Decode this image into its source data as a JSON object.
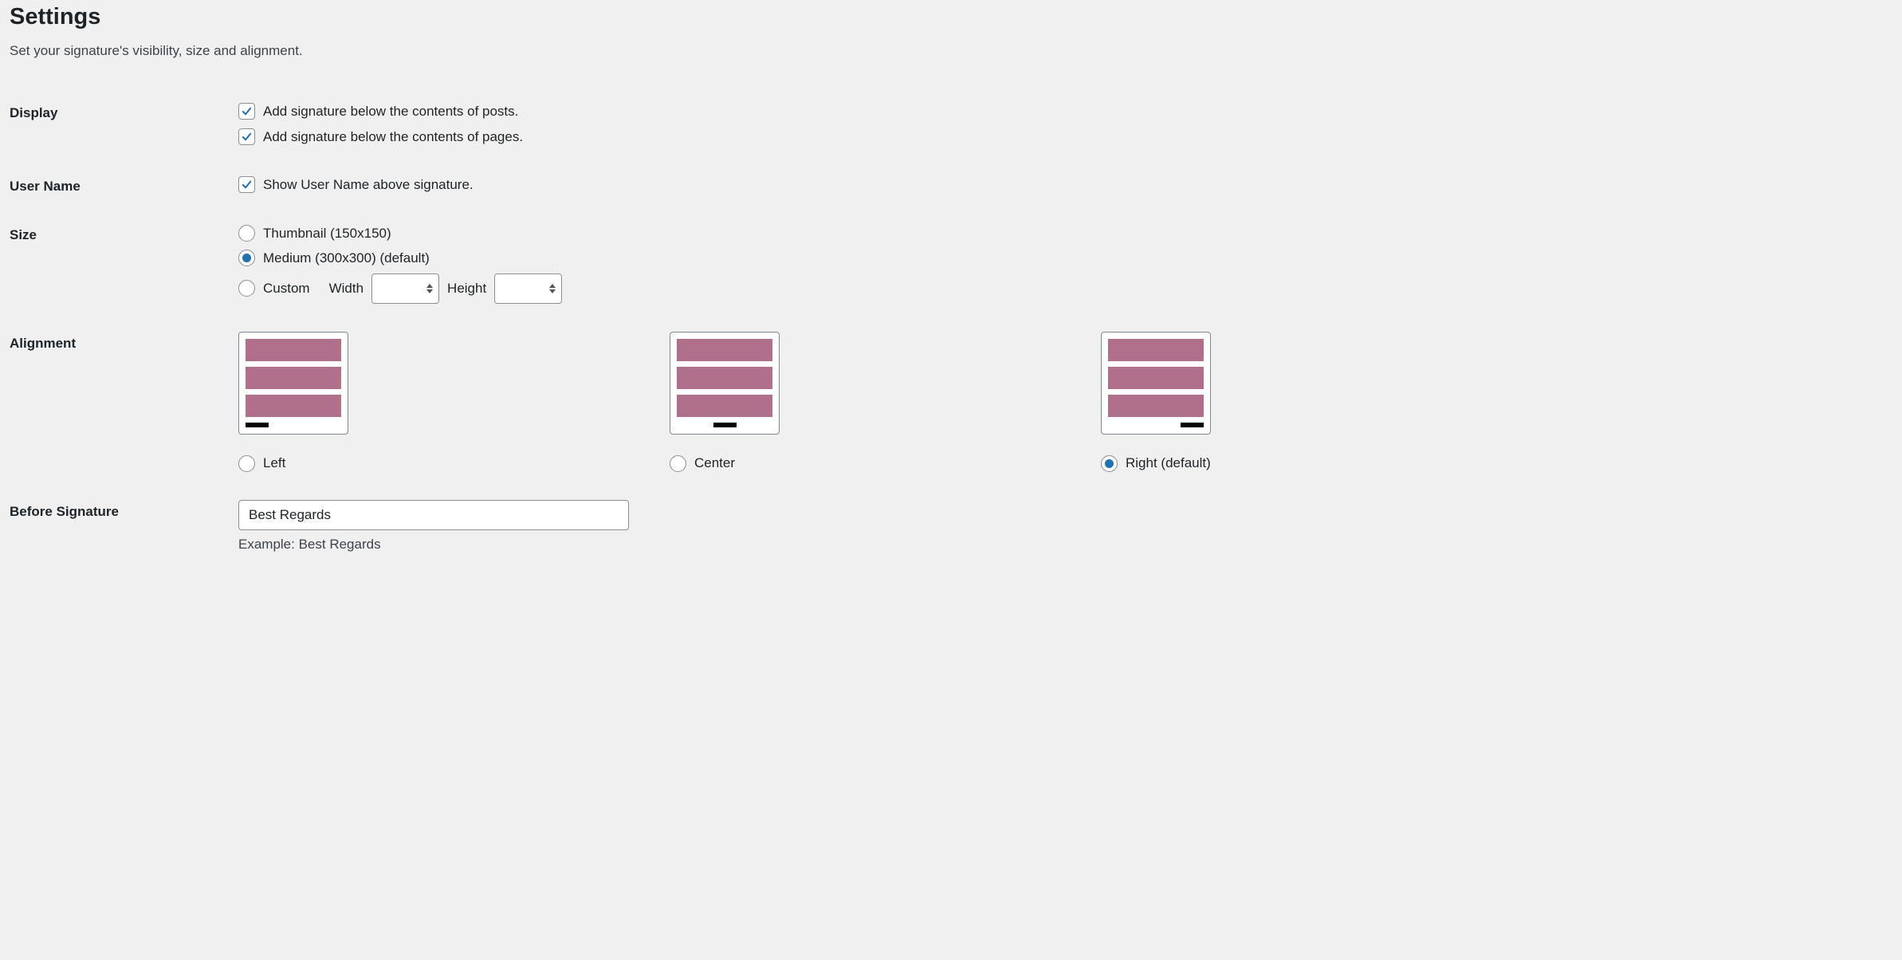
{
  "page": {
    "title": "Settings",
    "description": "Set your signature's visibility, size and alignment."
  },
  "display": {
    "section_label": "Display",
    "posts_label": "Add signature below the contents of posts.",
    "posts_checked": true,
    "pages_label": "Add signature below the contents of pages.",
    "pages_checked": true
  },
  "username": {
    "section_label": "User Name",
    "show_label": "Show User Name above signature.",
    "show_checked": true
  },
  "size": {
    "section_label": "Size",
    "options": {
      "thumbnail": {
        "label": "Thumbnail (150x150)",
        "checked": false
      },
      "medium": {
        "label": "Medium (300x300) (default)",
        "checked": true
      },
      "custom": {
        "label": "Custom",
        "checked": false
      }
    },
    "width_label": "Width",
    "height_label": "Height",
    "width_value": "",
    "height_value": ""
  },
  "alignment": {
    "section_label": "Alignment",
    "options": {
      "left": {
        "label": "Left",
        "checked": false
      },
      "center": {
        "label": "Center",
        "checked": false
      },
      "right": {
        "label": "Right (default)",
        "checked": true
      }
    }
  },
  "before_sig": {
    "section_label": "Before Signature",
    "value": "Best Regards",
    "helper": "Example: Best Regards"
  }
}
